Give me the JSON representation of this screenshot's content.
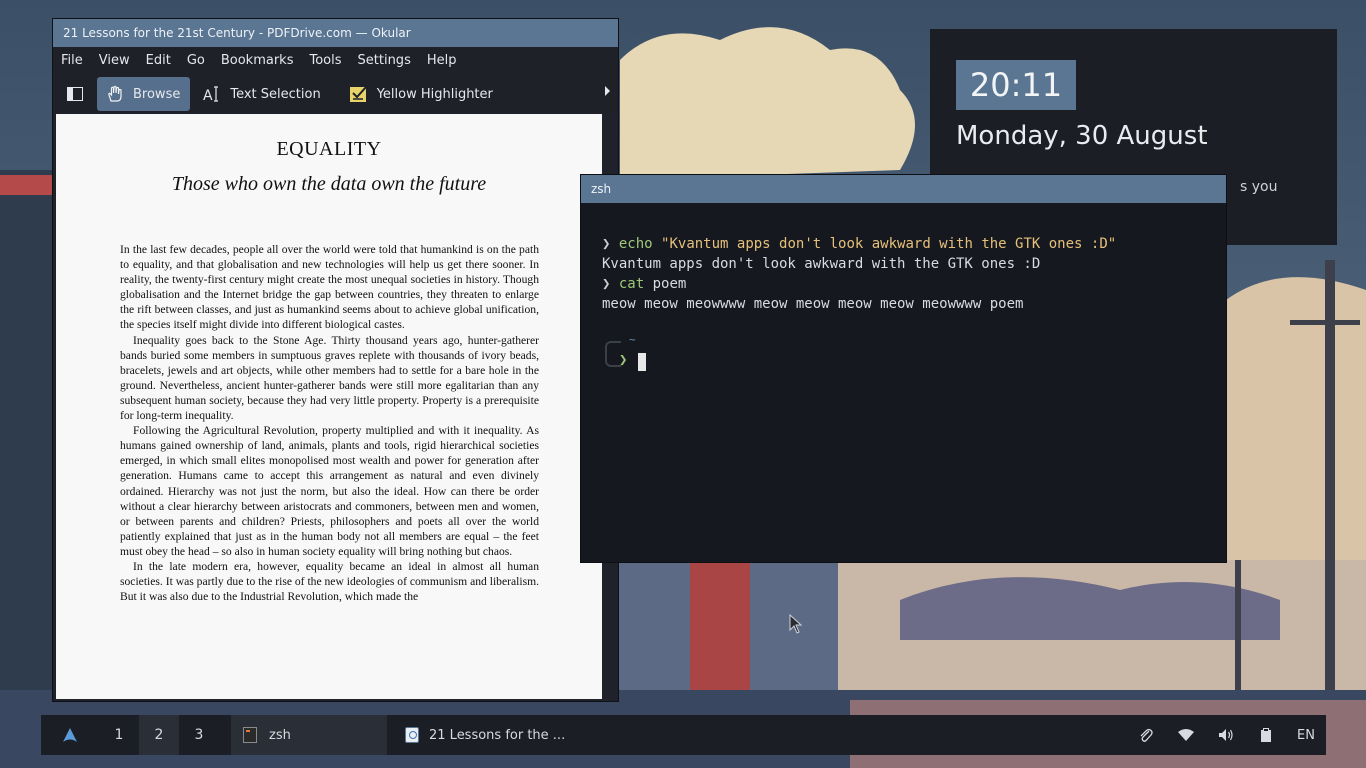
{
  "okular": {
    "title": "21 Lessons for the 21st Century - PDFDrive.com  — Okular",
    "menu": [
      "File",
      "View",
      "Edit",
      "Go",
      "Bookmarks",
      "Tools",
      "Settings",
      "Help"
    ],
    "toolbar": {
      "browse": "Browse",
      "text_selection": "Text Selection",
      "highlighter": "Yellow Highlighter"
    },
    "page": {
      "heading": "EQUALITY",
      "subheading": "Those who own the data own the future",
      "paragraphs": [
        "In the last few decades, people all over the world were told that humankind is on the path to equality, and that globalisation and new technologies will help us get there sooner. In reality, the twenty-first century might create the most unequal societies in history. Though globalisation and the Internet bridge the gap between countries, they threaten to enlarge the rift between classes, and just as humankind seems about to achieve global unification, the species itself might divide into different biological castes.",
        "Inequality goes back to the Stone Age. Thirty thousand years ago, hunter-gatherer bands buried some members in sumptuous graves replete with thousands of ivory beads, bracelets, jewels and art objects, while other members had to settle for a bare hole in the ground. Nevertheless, ancient hunter-gatherer bands were still more egalitarian than any subsequent human society, because they had very little property. Property is a prerequisite for long-term inequality.",
        "Following the Agricultural Revolution, property multiplied and with it inequality. As humans gained ownership of land, animals, plants and tools, rigid hierarchical societies emerged, in which small elites monopolised most wealth and power for generation after generation. Humans came to accept this arrangement as natural and even divinely ordained. Hierarchy was not just the norm, but also the ideal. How can there be order without a clear hierarchy between aristocrats and commoners, between men and women, or between parents and children? Priests, philosophers and poets all over the world patiently explained that just as in the human body not all members are equal – the feet must obey the head – so also in human society equality will bring nothing but chaos.",
        "In the late modern era, however, equality became an ideal in almost all human societies. It was partly due to the rise of the new ideologies of communism and liberalism. But it was also due to the Industrial Revolution, which made the"
      ]
    }
  },
  "clock": {
    "time": "20:11",
    "date": "Monday, 30 August",
    "note_fragment": "s you"
  },
  "terminal": {
    "title": "zsh",
    "prompt_symbol": "❯",
    "line1_cmd": "echo",
    "line1_arg": "\"Kvantum apps don't look awkward with the GTK ones :D\"",
    "line2_output": "Kvantum apps don't look awkward with the GTK ones :D",
    "line3_cmd": "cat",
    "line3_arg": "poem",
    "line4_output": "meow meow meowwww meow meow meow meow meowwww poem",
    "cwd": "~"
  },
  "taskbar": {
    "desktops": [
      "1",
      "2",
      "3"
    ],
    "current_desktop": "2",
    "tasks": [
      {
        "label": "zsh",
        "icon": "terminal-icon"
      },
      {
        "label": "21 Lessons for the ...",
        "icon": "okular-icon"
      }
    ],
    "tray": {
      "lang": "EN"
    }
  },
  "colors": {
    "accent": "#5a7693",
    "panel": "#1b1e25",
    "terminal_bg": "#15181e",
    "cmd_green": "#9fc97a",
    "string_yellow": "#e6c07b"
  }
}
